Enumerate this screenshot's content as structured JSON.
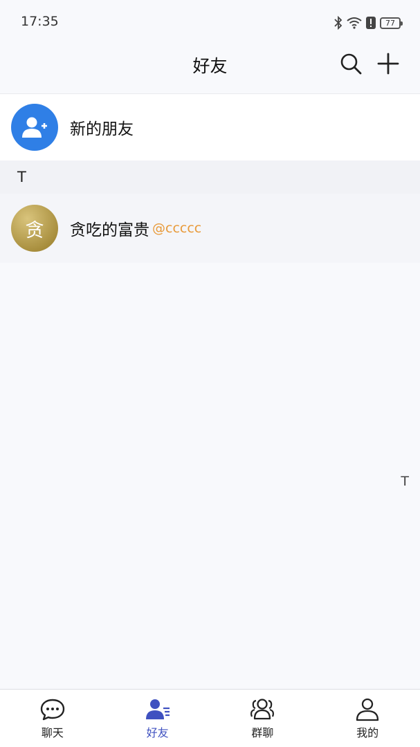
{
  "status_bar": {
    "time": "17:35",
    "battery_level": "77",
    "icons": [
      "bluetooth-icon",
      "wifi-icon",
      "alert-icon",
      "battery-icon"
    ]
  },
  "header": {
    "title": "好友",
    "actions": [
      "search-icon",
      "plus-icon"
    ]
  },
  "new_friends": {
    "label": "新的朋友",
    "icon": "add-user-icon"
  },
  "sections": [
    {
      "letter": "T",
      "contacts": [
        {
          "avatar_char": "贪",
          "name": "贪吃的富贵",
          "handle": "@ccccc"
        }
      ]
    }
  ],
  "index_bar": {
    "letters": [
      "T"
    ]
  },
  "tabs": [
    {
      "label": "聊天",
      "icon": "chat-bubble-icon",
      "active": false
    },
    {
      "label": "好友",
      "icon": "friends-icon",
      "active": true
    },
    {
      "label": "群聊",
      "icon": "group-icon",
      "active": false
    },
    {
      "label": "我的",
      "icon": "profile-icon",
      "active": false
    }
  ],
  "colors": {
    "accent": "#3f51c0",
    "avatar_blue": "#2f7fe6",
    "handle": "#e89a3a"
  }
}
